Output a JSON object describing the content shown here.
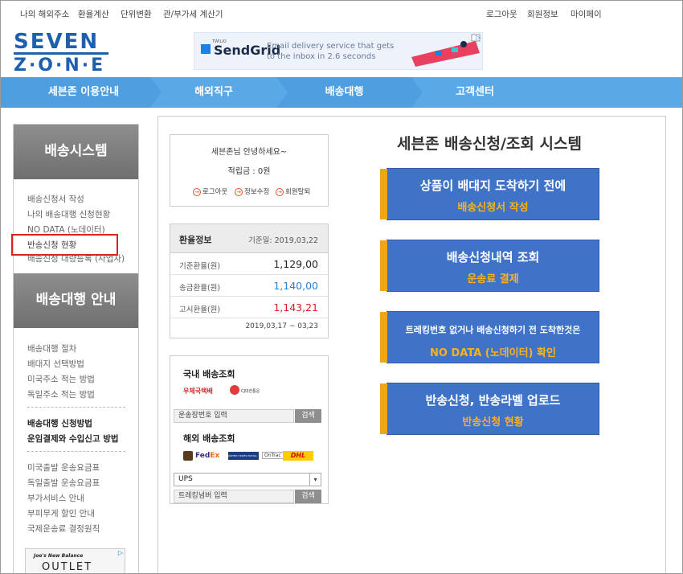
{
  "topbar": {
    "left_links": [
      "나의 해외주소",
      "환율계산",
      "단위변환",
      "관/부가세 계산기"
    ],
    "right_links": [
      "로그아웃",
      "회원정보",
      "마이페이"
    ]
  },
  "logo": {
    "line1": "SEVEN",
    "line2": "Z·O·N·E"
  },
  "banner": {
    "brand_small": "TWILIO",
    "brand": "SendGrid",
    "text": "Email delivery service that gets to the inbox in 2.6 seconds"
  },
  "nav": [
    "세븐존 이용안내",
    "해외직구",
    "배송대행",
    "고객센터"
  ],
  "sidebar": {
    "section1_title": "배송시스템",
    "section1_links": [
      "배송신청서 작성",
      "나의 배송대행 신청현황",
      "NO DATA (노데이터)",
      "반송신청 현황",
      "배송신청 대량등록 (사업자)"
    ],
    "section2_title": "배송대행 안내",
    "section2_group1": [
      "배송대행 절차",
      "배대지 선택방법",
      "미국주소 적는 방법",
      "독일주소 적는 방법"
    ],
    "section2_group2": [
      "배송대행 신청방법",
      "운임결제와 수입신고 방법"
    ],
    "section2_group3": [
      "미국출발 운송요금표",
      "독일출발 운송요금표",
      "부가서비스 안내",
      "부피무게 할인 안내",
      "국제운송료 결정원칙"
    ],
    "ad_text1": "Joe's New Balance",
    "ad_text2": "OUTLET"
  },
  "user": {
    "greeting": "세븐존님 안녕하세요~",
    "points": "적립금 : 0원",
    "actions": [
      "로그아웃",
      "정보수정",
      "회원탈퇴"
    ]
  },
  "rates": {
    "title": "환율정보",
    "base_date": "기준일: 2019,03,22",
    "rows": [
      {
        "label": "기준환율(원)",
        "value": "1,129,00",
        "color": "#222222"
      },
      {
        "label": "송금환율(원)",
        "value": "1,140,00",
        "color": "#2a7fd0"
      },
      {
        "label": "고시환율(원)",
        "value": "1,143,21",
        "color": "#d82020"
      }
    ],
    "period": "2019,03,17 ~ 03,23"
  },
  "tracking": {
    "domestic_title": "국내 배송조회",
    "domestic_carriers": [
      "우체국택배",
      "CJ대한통운"
    ],
    "domestic_placeholder": "운송장번호 입력",
    "search_label": "검색",
    "intl_title": "해외 배송조회",
    "intl_carriers": [
      "UPS",
      "FedEx",
      "UNITED STATES POSTAL SERVICE",
      "OnTrac",
      "DHL"
    ],
    "intl_selected": "UPS",
    "intl_placeholder": "트레킹넘버 입력",
    "search_label2": "검색"
  },
  "main": {
    "headline": "세븐존 배송신청/조회 시스템",
    "buttons": [
      {
        "line1": "상품이 배대지 도착하기 전에",
        "line2": "배송신청서 작성"
      },
      {
        "line1": "배송신청내역 조회",
        "line2": "운송료 결제"
      },
      {
        "line1": "트레킹번호 없거나 배송신청하기 전 도착한것은",
        "line2": "NO DATA (노데이터) 확인"
      },
      {
        "line1": "반송신청, 반송라벨 업로드",
        "line2": "반송신청 현황"
      }
    ]
  }
}
